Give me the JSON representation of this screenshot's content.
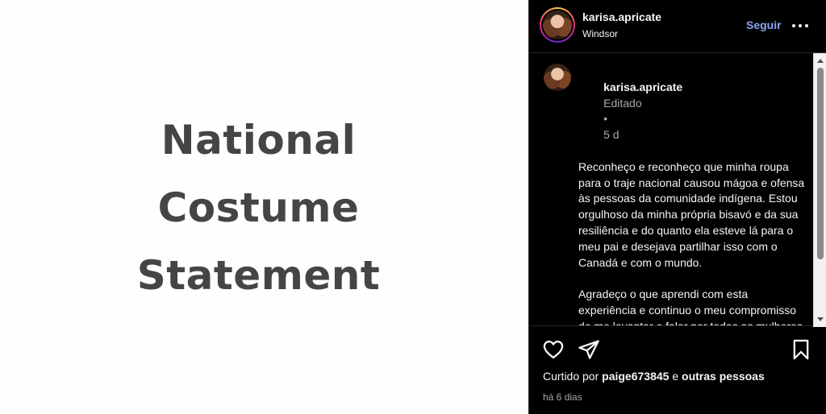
{
  "left": {
    "title_lines": [
      "National",
      "Costume",
      "Statement"
    ]
  },
  "post": {
    "username": "karisa.apricate",
    "location": "Windsor",
    "follow_label": "Seguir",
    "more_icon": "more-horizontal-icon",
    "caption": {
      "username": "karisa.apricate",
      "edited_label": "Editado",
      "separator": "•",
      "age": "5 d",
      "paragraph1": "Reconheço e reconheço que minha roupa para o traje nacional causou mágoa e ofensa às pessoas da comunidade indígena. Estou orgulhoso da minha própria bisavó e da sua resiliência e do quanto ela esteve lá para o meu pai e desejava partilhar isso com o Canadá e com o mundo.",
      "paragraph2": "Agradeço o que aprendi com esta experiência e continuo o meu compromisso de me levantar e falar por todas as mulheres que perderam a voz por causa da violência, trauma e opressão."
    },
    "actions": {
      "like_icon": "heart-icon",
      "share_icon": "send-icon",
      "save_icon": "bookmark-icon"
    },
    "likes": {
      "prefix": "Curtido por",
      "user": "paige673845",
      "connector": "e",
      "others": "outras pessoas"
    },
    "time": "há 6 dias"
  },
  "colors": {
    "background_dark": "#000000",
    "follow_blue": "#8ea4f5",
    "headline_gray": "#454545",
    "muted_text": "#a8a8a8"
  }
}
